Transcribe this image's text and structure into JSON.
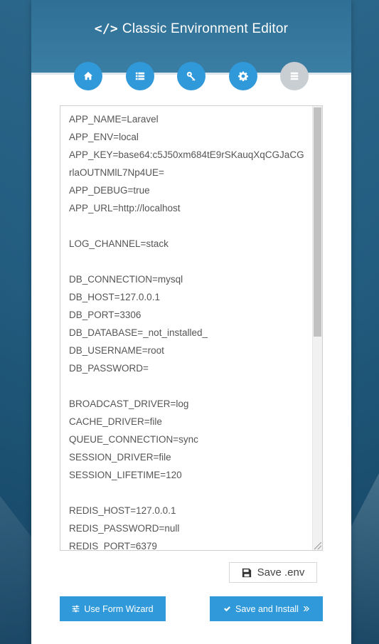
{
  "header": {
    "title_icon": "</>",
    "title": "Classic Environment Editor"
  },
  "steps": [
    {
      "icon": "home-icon",
      "state": "active"
    },
    {
      "icon": "list-icon",
      "state": "active"
    },
    {
      "icon": "key-icon",
      "state": "active"
    },
    {
      "icon": "gear-icon",
      "state": "active"
    },
    {
      "icon": "server-icon",
      "state": "inactive"
    }
  ],
  "editor": {
    "lines": [
      "APP_NAME=Laravel",
      "APP_ENV=local",
      "APP_KEY=base64:c5J50xm684tE9rSKauqXqCGJaCG",
      "rlaOUTNMlL7Np4UE=",
      "APP_DEBUG=true",
      "APP_URL=http://localhost",
      "",
      "LOG_CHANNEL=stack",
      "",
      "DB_CONNECTION=mysql",
      "DB_HOST=127.0.0.1",
      "DB_PORT=3306",
      "DB_DATABASE=_not_installed_",
      "DB_USERNAME=root",
      "DB_PASSWORD=",
      "",
      "BROADCAST_DRIVER=log",
      "CACHE_DRIVER=file",
      "QUEUE_CONNECTION=sync",
      "SESSION_DRIVER=file",
      "SESSION_LIFETIME=120",
      "",
      "REDIS_HOST=127.0.0.1",
      "REDIS_PASSWORD=null",
      "REDIS_PORT=6379"
    ]
  },
  "buttons": {
    "save_env": "Save .env",
    "use_form_wizard": "Use Form Wizard",
    "save_and_install": "Save and Install"
  },
  "colors": {
    "accent": "#2f99d9",
    "header": "#3b7ea3",
    "inactive_step": "#c9ced2"
  }
}
